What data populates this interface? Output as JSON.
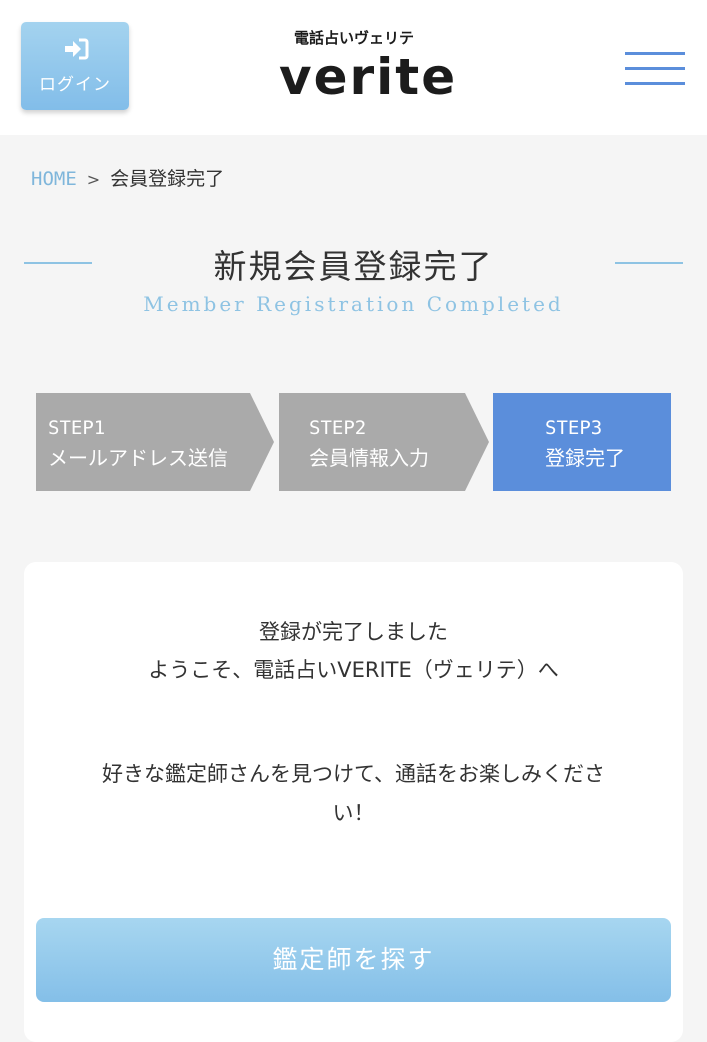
{
  "header": {
    "login_label": "ログイン",
    "logo_sub": "電話占いヴェリテ",
    "logo_main": "verite"
  },
  "breadcrumb": {
    "home": "HOME",
    "separator": ">",
    "current": "会員登録完了"
  },
  "page": {
    "title": "新規会員登録完了",
    "subtitle": "Member Registration Completed"
  },
  "steps": [
    {
      "number": "STEP1",
      "label": "メールアドレス送信",
      "state": "done"
    },
    {
      "number": "STEP2",
      "label": "会員情報入力",
      "state": "done"
    },
    {
      "number": "STEP3",
      "label": "登録完了",
      "state": "current"
    }
  ],
  "content": {
    "line1": "登録が完了しました",
    "line2": "ようこそ、電話占いVERITE（ヴェリテ）へ",
    "line3a": "好きな鑑定師さんを見つけて、通話をお楽しみくださ",
    "line3b": "い！",
    "cta_label": "鑑定師を探す"
  },
  "colors": {
    "accent_blue": "#5b8edb",
    "light_blue": "#8ec3e3",
    "step_inactive": "#aaaaaa",
    "background": "#f5f5f5"
  }
}
